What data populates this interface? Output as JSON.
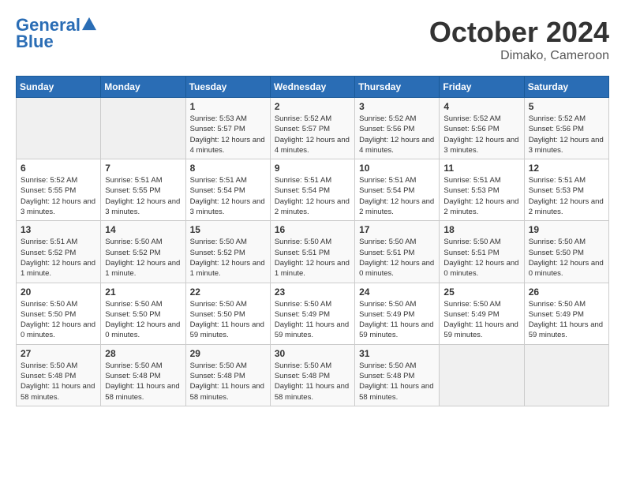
{
  "header": {
    "logo_line1": "General",
    "logo_line2": "Blue",
    "month": "October 2024",
    "location": "Dimako, Cameroon"
  },
  "weekdays": [
    "Sunday",
    "Monday",
    "Tuesday",
    "Wednesday",
    "Thursday",
    "Friday",
    "Saturday"
  ],
  "weeks": [
    [
      {
        "day": "",
        "info": ""
      },
      {
        "day": "",
        "info": ""
      },
      {
        "day": "1",
        "info": "Sunrise: 5:53 AM\nSunset: 5:57 PM\nDaylight: 12 hours and 4 minutes."
      },
      {
        "day": "2",
        "info": "Sunrise: 5:52 AM\nSunset: 5:57 PM\nDaylight: 12 hours and 4 minutes."
      },
      {
        "day": "3",
        "info": "Sunrise: 5:52 AM\nSunset: 5:56 PM\nDaylight: 12 hours and 4 minutes."
      },
      {
        "day": "4",
        "info": "Sunrise: 5:52 AM\nSunset: 5:56 PM\nDaylight: 12 hours and 3 minutes."
      },
      {
        "day": "5",
        "info": "Sunrise: 5:52 AM\nSunset: 5:56 PM\nDaylight: 12 hours and 3 minutes."
      }
    ],
    [
      {
        "day": "6",
        "info": "Sunrise: 5:52 AM\nSunset: 5:55 PM\nDaylight: 12 hours and 3 minutes."
      },
      {
        "day": "7",
        "info": "Sunrise: 5:51 AM\nSunset: 5:55 PM\nDaylight: 12 hours and 3 minutes."
      },
      {
        "day": "8",
        "info": "Sunrise: 5:51 AM\nSunset: 5:54 PM\nDaylight: 12 hours and 3 minutes."
      },
      {
        "day": "9",
        "info": "Sunrise: 5:51 AM\nSunset: 5:54 PM\nDaylight: 12 hours and 2 minutes."
      },
      {
        "day": "10",
        "info": "Sunrise: 5:51 AM\nSunset: 5:54 PM\nDaylight: 12 hours and 2 minutes."
      },
      {
        "day": "11",
        "info": "Sunrise: 5:51 AM\nSunset: 5:53 PM\nDaylight: 12 hours and 2 minutes."
      },
      {
        "day": "12",
        "info": "Sunrise: 5:51 AM\nSunset: 5:53 PM\nDaylight: 12 hours and 2 minutes."
      }
    ],
    [
      {
        "day": "13",
        "info": "Sunrise: 5:51 AM\nSunset: 5:52 PM\nDaylight: 12 hours and 1 minute."
      },
      {
        "day": "14",
        "info": "Sunrise: 5:50 AM\nSunset: 5:52 PM\nDaylight: 12 hours and 1 minute."
      },
      {
        "day": "15",
        "info": "Sunrise: 5:50 AM\nSunset: 5:52 PM\nDaylight: 12 hours and 1 minute."
      },
      {
        "day": "16",
        "info": "Sunrise: 5:50 AM\nSunset: 5:51 PM\nDaylight: 12 hours and 1 minute."
      },
      {
        "day": "17",
        "info": "Sunrise: 5:50 AM\nSunset: 5:51 PM\nDaylight: 12 hours and 0 minutes."
      },
      {
        "day": "18",
        "info": "Sunrise: 5:50 AM\nSunset: 5:51 PM\nDaylight: 12 hours and 0 minutes."
      },
      {
        "day": "19",
        "info": "Sunrise: 5:50 AM\nSunset: 5:50 PM\nDaylight: 12 hours and 0 minutes."
      }
    ],
    [
      {
        "day": "20",
        "info": "Sunrise: 5:50 AM\nSunset: 5:50 PM\nDaylight: 12 hours and 0 minutes."
      },
      {
        "day": "21",
        "info": "Sunrise: 5:50 AM\nSunset: 5:50 PM\nDaylight: 12 hours and 0 minutes."
      },
      {
        "day": "22",
        "info": "Sunrise: 5:50 AM\nSunset: 5:50 PM\nDaylight: 11 hours and 59 minutes."
      },
      {
        "day": "23",
        "info": "Sunrise: 5:50 AM\nSunset: 5:49 PM\nDaylight: 11 hours and 59 minutes."
      },
      {
        "day": "24",
        "info": "Sunrise: 5:50 AM\nSunset: 5:49 PM\nDaylight: 11 hours and 59 minutes."
      },
      {
        "day": "25",
        "info": "Sunrise: 5:50 AM\nSunset: 5:49 PM\nDaylight: 11 hours and 59 minutes."
      },
      {
        "day": "26",
        "info": "Sunrise: 5:50 AM\nSunset: 5:49 PM\nDaylight: 11 hours and 59 minutes."
      }
    ],
    [
      {
        "day": "27",
        "info": "Sunrise: 5:50 AM\nSunset: 5:48 PM\nDaylight: 11 hours and 58 minutes."
      },
      {
        "day": "28",
        "info": "Sunrise: 5:50 AM\nSunset: 5:48 PM\nDaylight: 11 hours and 58 minutes."
      },
      {
        "day": "29",
        "info": "Sunrise: 5:50 AM\nSunset: 5:48 PM\nDaylight: 11 hours and 58 minutes."
      },
      {
        "day": "30",
        "info": "Sunrise: 5:50 AM\nSunset: 5:48 PM\nDaylight: 11 hours and 58 minutes."
      },
      {
        "day": "31",
        "info": "Sunrise: 5:50 AM\nSunset: 5:48 PM\nDaylight: 11 hours and 58 minutes."
      },
      {
        "day": "",
        "info": ""
      },
      {
        "day": "",
        "info": ""
      }
    ]
  ]
}
